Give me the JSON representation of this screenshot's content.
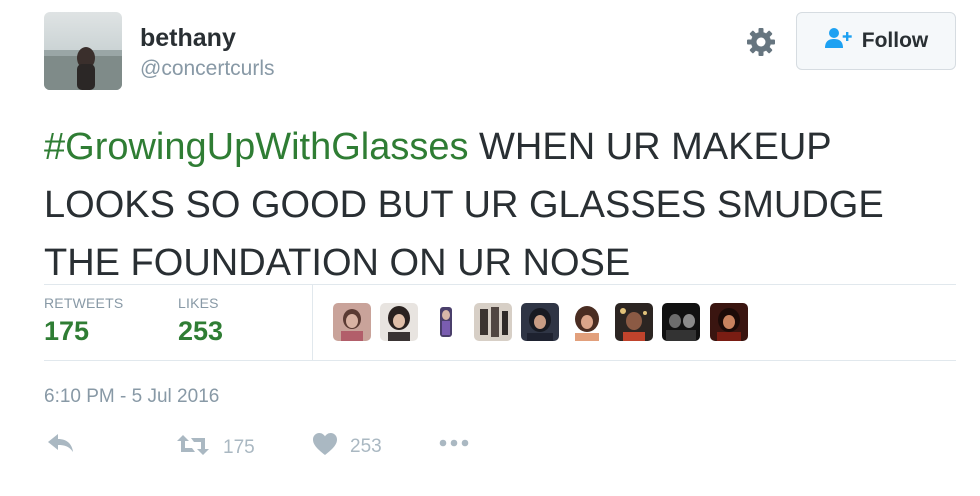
{
  "user": {
    "name": "bethany",
    "handle": "@concertcurls"
  },
  "follow_button": {
    "label": "Follow"
  },
  "tweet": {
    "hashtag": "#GrowingUpWithGlasses",
    "text": " WHEN UR MAKEUP LOOKS SO GOOD BUT UR GLASSES SMUDGE THE FOUNDATION ON UR NOSE"
  },
  "stats": {
    "retweets_label": "RETWEETS",
    "retweets_value": "175",
    "likes_label": "LIKES",
    "likes_value": "253"
  },
  "timestamp": "6:10 PM - 5 Jul 2016",
  "actions": {
    "retweet_count": "175",
    "like_count": "253"
  },
  "colors": {
    "hashtag": "#2f7d34",
    "text": "#292f33",
    "muted": "#8899a6",
    "icon": "#aab8c2",
    "follow_icon": "#1da1f2"
  },
  "icons": {
    "settings": "gear-icon",
    "follow": "person-plus-icon",
    "reply": "reply-icon",
    "retweet": "retweet-icon",
    "like": "heart-icon",
    "more": "more-dots-icon"
  }
}
